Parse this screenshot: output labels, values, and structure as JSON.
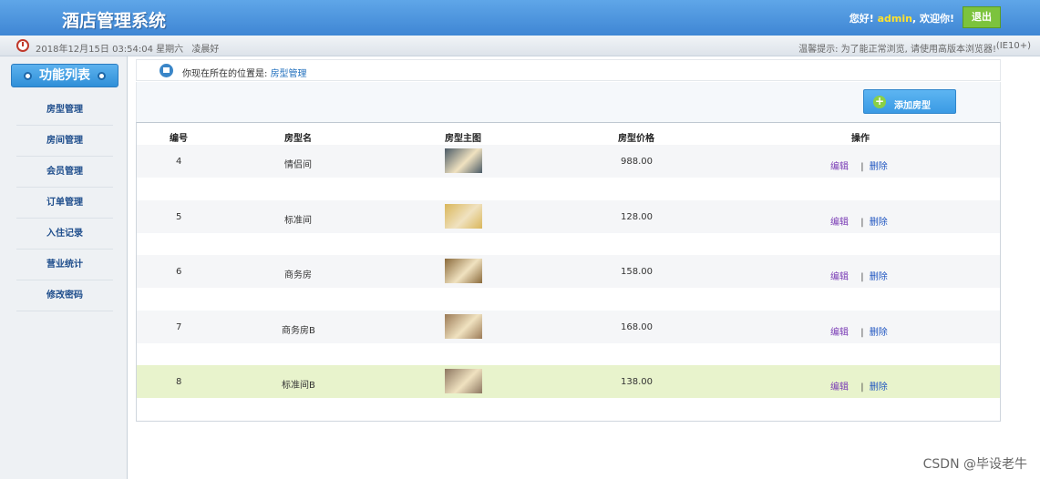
{
  "header": {
    "title": "酒店管理系统",
    "greeting_prefix": "您好!",
    "username": "admin",
    "greeting_suffix": ", 欢迎你!",
    "logout_label": "退出"
  },
  "statusbar": {
    "datetime": "2018年12月15日 03:54:04 星期六",
    "period_greeting": "凌晨好",
    "tip": "温馨提示: 为了能正常浏览, 请使用高版本浏览器!",
    "ie_note": "(IE10+)"
  },
  "sidebar": {
    "heading": "功能列表",
    "items": [
      {
        "label": "房型管理"
      },
      {
        "label": "房间管理"
      },
      {
        "label": "会员管理"
      },
      {
        "label": "订单管理"
      },
      {
        "label": "入住记录"
      },
      {
        "label": "营业统计"
      },
      {
        "label": "修改密码"
      }
    ]
  },
  "breadcrumb": {
    "prefix": "你现在所在的位置是:",
    "current": "房型管理"
  },
  "toolbar": {
    "add_label": "添加房型"
  },
  "table": {
    "headers": [
      "编号",
      "房型名",
      "房型主图",
      "房型价格",
      "操作"
    ],
    "rows": [
      {
        "id": "4",
        "name": "情侣间",
        "price": "988.00",
        "thumb_color": "#4a5a66"
      },
      {
        "id": "5",
        "name": "标准间",
        "price": "128.00",
        "thumb_color": "#d9b65a"
      },
      {
        "id": "6",
        "name": "商务房",
        "price": "158.00",
        "thumb_color": "#8a6a3c"
      },
      {
        "id": "7",
        "name": "商务房B",
        "price": "168.00",
        "thumb_color": "#9b7a56"
      },
      {
        "id": "8",
        "name": "标准间B",
        "price": "138.00",
        "thumb_color": "#8c7660"
      }
    ],
    "edit_label": "编辑",
    "separator": "|",
    "delete_label": "删除",
    "highlight_color": "#e8f3cc"
  },
  "watermark": "CSDN @毕设老牛",
  "icons": {
    "clock": "clock-icon",
    "home": "home-icon",
    "plus": "plus-icon"
  }
}
